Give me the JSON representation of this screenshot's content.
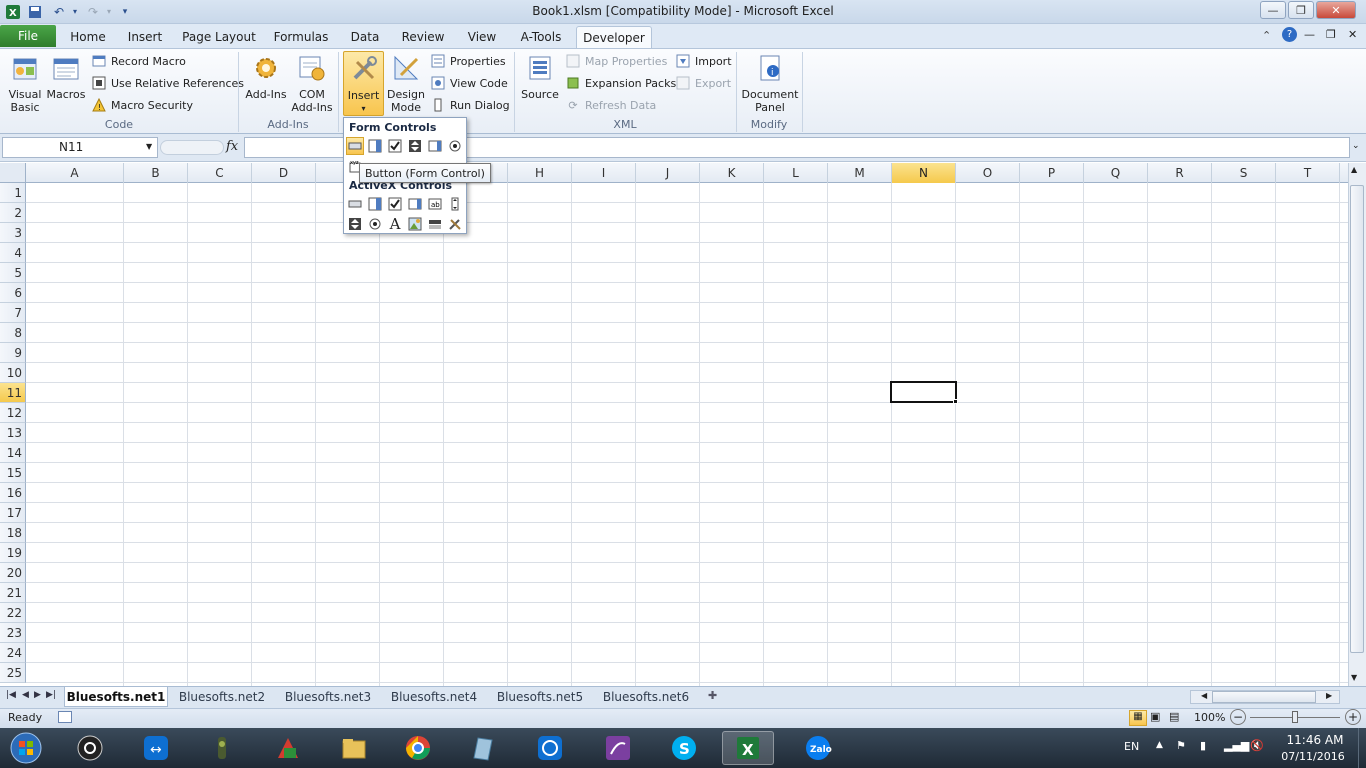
{
  "window": {
    "title": "Book1.xlsm  [Compatibility Mode]  -  Microsoft Excel"
  },
  "ribbon_tabs": [
    "File",
    "Home",
    "Insert",
    "Page Layout",
    "Formulas",
    "Data",
    "Review",
    "View",
    "A-Tools",
    "Developer"
  ],
  "active_tab": "Developer",
  "code_group": {
    "label": "Code",
    "visual_basic": "Visual\nBasic",
    "macros": "Macros",
    "record_macro": "Record Macro",
    "use_relative": "Use Relative References",
    "macro_security": "Macro Security"
  },
  "addins_group": {
    "label": "Add-Ins",
    "addins": "Add-Ins",
    "com_addins": "COM\nAdd-Ins"
  },
  "controls_group": {
    "insert": "Insert",
    "design_mode": "Design\nMode",
    "properties": "Properties",
    "view_code": "View Code",
    "run_dialog": "Run Dialog"
  },
  "xml_group": {
    "label": "XML",
    "source": "Source",
    "map_properties": "Map Properties",
    "expansion_packs": "Expansion Packs",
    "refresh_data": "Refresh Data",
    "import": "Import",
    "export": "Export"
  },
  "modify_group": {
    "label": "Modify",
    "document_panel": "Document\nPanel"
  },
  "formula_bar": {
    "name_box": "N11",
    "fx": "fx",
    "value": ""
  },
  "dropdown": {
    "form_controls": "Form Controls",
    "activex_controls": "ActiveX Controls",
    "tooltip": "Button (Form Control)"
  },
  "columns": [
    "A",
    "B",
    "C",
    "D",
    "E",
    "F",
    "G",
    "H",
    "I",
    "J",
    "K",
    "L",
    "M",
    "N",
    "O",
    "P",
    "Q",
    "R",
    "S",
    "T"
  ],
  "rows": [
    "1",
    "2",
    "3",
    "4",
    "5",
    "6",
    "7",
    "8",
    "9",
    "10",
    "11",
    "12",
    "13",
    "14",
    "15",
    "16",
    "17",
    "18",
    "19",
    "20",
    "21",
    "22",
    "23",
    "24",
    "25"
  ],
  "active_cell": {
    "column": "N",
    "row": "11"
  },
  "sheets": [
    "Bluesofts.net1",
    "Bluesofts.net2",
    "Bluesofts.net3",
    "Bluesofts.net4",
    "Bluesofts.net5",
    "Bluesofts.net6"
  ],
  "active_sheet": "Bluesofts.net1",
  "status": {
    "ready": "Ready",
    "zoom": "100%"
  },
  "tray": {
    "language": "EN",
    "time": "11:46 AM",
    "date": "07/11/2016"
  },
  "taskbar_apps": [
    "start",
    "obs",
    "teamviewer",
    "audio",
    "winrar",
    "file-explorer",
    "chrome",
    "notepad",
    "teamviewer2",
    "onenote",
    "skype",
    "excel",
    "zalo"
  ],
  "colors": {
    "accent_green": "#2f7d2c",
    "selected_header": "#f5c94c",
    "taskbar": "#1f2a36"
  }
}
